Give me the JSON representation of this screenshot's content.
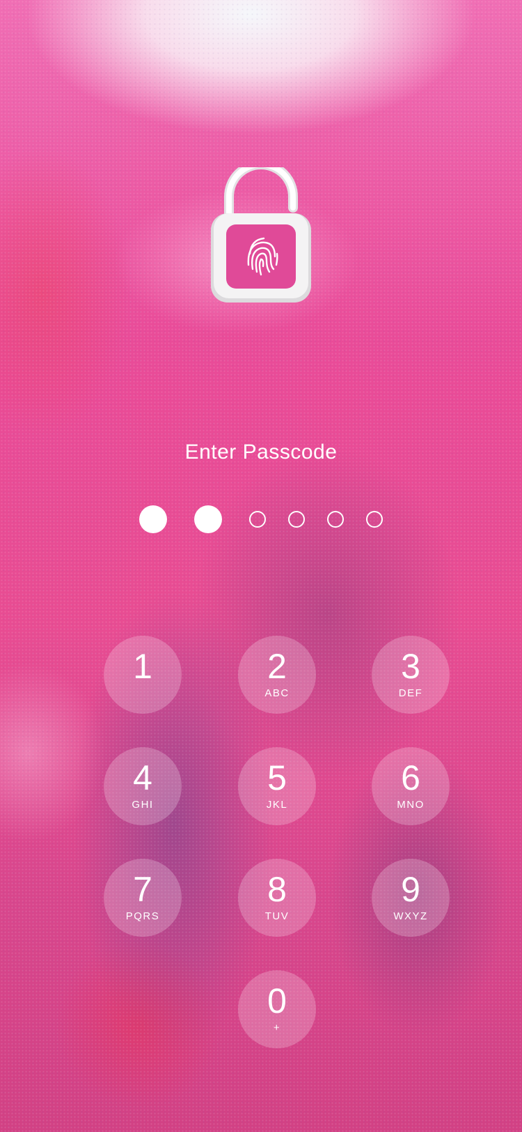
{
  "screen": {
    "prompt": "Enter Passcode"
  },
  "colors": {
    "foreground": "#ffffff",
    "key_fill": "rgba(255,255,255,0.22)",
    "background_accent": "#e94b98"
  },
  "lock_icon": {
    "name": "unlocked-padlock-fingerprint-icon"
  },
  "passcode": {
    "length": 6,
    "entered": 2
  },
  "keypad": {
    "keys": [
      {
        "digit": "1",
        "letters": ""
      },
      {
        "digit": "2",
        "letters": "ABC"
      },
      {
        "digit": "3",
        "letters": "DEF"
      },
      {
        "digit": "4",
        "letters": "GHI"
      },
      {
        "digit": "5",
        "letters": "JKL"
      },
      {
        "digit": "6",
        "letters": "MNO"
      },
      {
        "digit": "7",
        "letters": "PQRS"
      },
      {
        "digit": "8",
        "letters": "TUV"
      },
      {
        "digit": "9",
        "letters": "WXYZ"
      },
      {
        "digit": "0",
        "letters": "+"
      }
    ]
  }
}
